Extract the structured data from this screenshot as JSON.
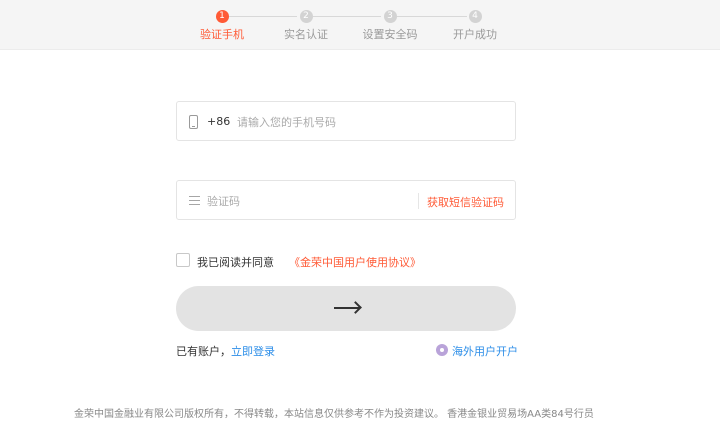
{
  "steps": [
    {
      "num": "1",
      "label": "验证手机"
    },
    {
      "num": "2",
      "label": "实名认证"
    },
    {
      "num": "3",
      "label": "设置安全码"
    },
    {
      "num": "4",
      "label": "开户成功"
    }
  ],
  "phone": {
    "country_code": "+86",
    "placeholder": "请输入您的手机号码"
  },
  "code": {
    "placeholder": "验证码",
    "sms_label": "获取短信验证码"
  },
  "agreement": {
    "text": "我已阅读并同意",
    "link": "《金荣中国用户使用协议》"
  },
  "submit": {
    "icon": "arrow-right-icon"
  },
  "login": {
    "prefix": "已有账户，",
    "link": "立即登录"
  },
  "overseas": {
    "label": "海外用户开户",
    "icon": "globe-icon"
  },
  "footer": {
    "text": "金荣中国金融业有限公司版权所有，不得转载，本站信息仅供参考不作为投资建议。 香港金银业贸易场AA类84号行员"
  },
  "colors": {
    "accent": "#ff5a36",
    "link": "#2c8ee8",
    "button": "#e3e3e3"
  }
}
